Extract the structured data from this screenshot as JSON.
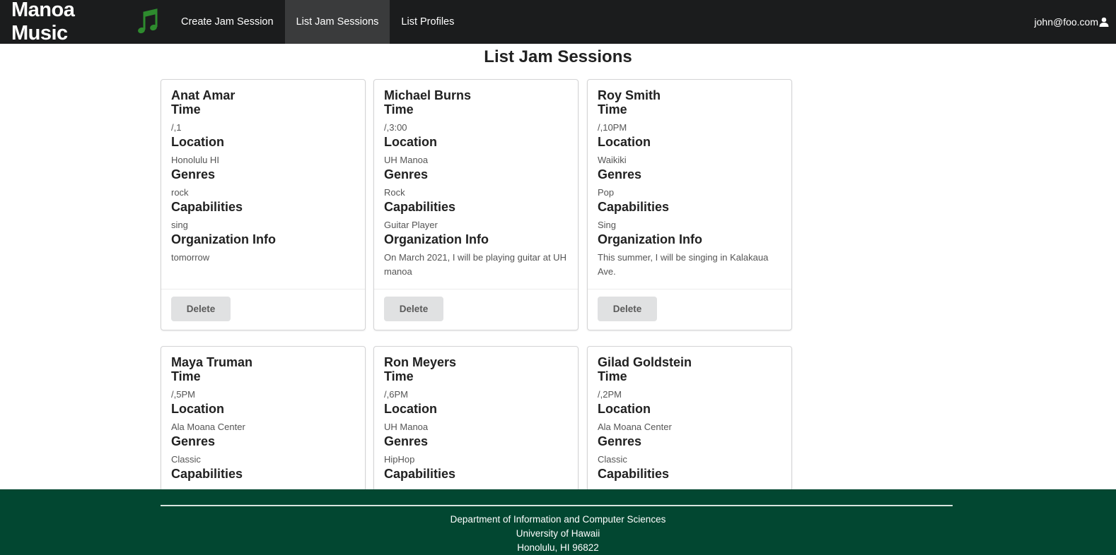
{
  "navbar": {
    "brand": "Manoa Music",
    "items": [
      {
        "label": "Create Jam Session",
        "active": false
      },
      {
        "label": "List Jam Sessions",
        "active": true
      },
      {
        "label": "List Profiles",
        "active": false
      }
    ],
    "user": "john@foo.com"
  },
  "page": {
    "title": "List Jam Sessions"
  },
  "labels": {
    "time": "Time",
    "location": "Location",
    "genres": "Genres",
    "capabilities": "Capabilities",
    "organization": "Organization Info",
    "delete": "Delete"
  },
  "sessions": [
    {
      "name": "Anat Amar",
      "time": "/,1",
      "location": "Honolulu HI",
      "genres": "rock",
      "capabilities": "sing",
      "organization": "tomorrow"
    },
    {
      "name": "Michael Burns",
      "time": "/,3:00",
      "location": "UH Manoa",
      "genres": "Rock",
      "capabilities": "Guitar Player",
      "organization": "On March 2021, I will be playing guitar at UH manoa"
    },
    {
      "name": "Roy Smith",
      "time": "/,10PM",
      "location": "Waikiki",
      "genres": "Pop",
      "capabilities": "Sing",
      "organization": "This summer, I will be singing in Kalakaua Ave."
    },
    {
      "name": "Maya Truman",
      "time": "/,5PM",
      "location": "Ala Moana Center",
      "genres": "Classic",
      "capabilities": "",
      "organization": ""
    },
    {
      "name": "Ron Meyers",
      "time": "/,6PM",
      "location": "UH Manoa",
      "genres": "HipHop",
      "capabilities": "",
      "organization": ""
    },
    {
      "name": "Gilad Goldstein",
      "time": "/,2PM",
      "location": "Ala Moana Center",
      "genres": "Classic",
      "capabilities": "",
      "organization": ""
    }
  ],
  "footer": {
    "line1": "Department of Information and Computer Sciences",
    "line2": "University of Hawaii",
    "line3": "Honolulu, HI 96822"
  },
  "colors": {
    "navbar": "#1b1c1d",
    "navbar_active": "#3a3b3c",
    "footer": "#024731",
    "note_icon": "#2e8b2e"
  }
}
